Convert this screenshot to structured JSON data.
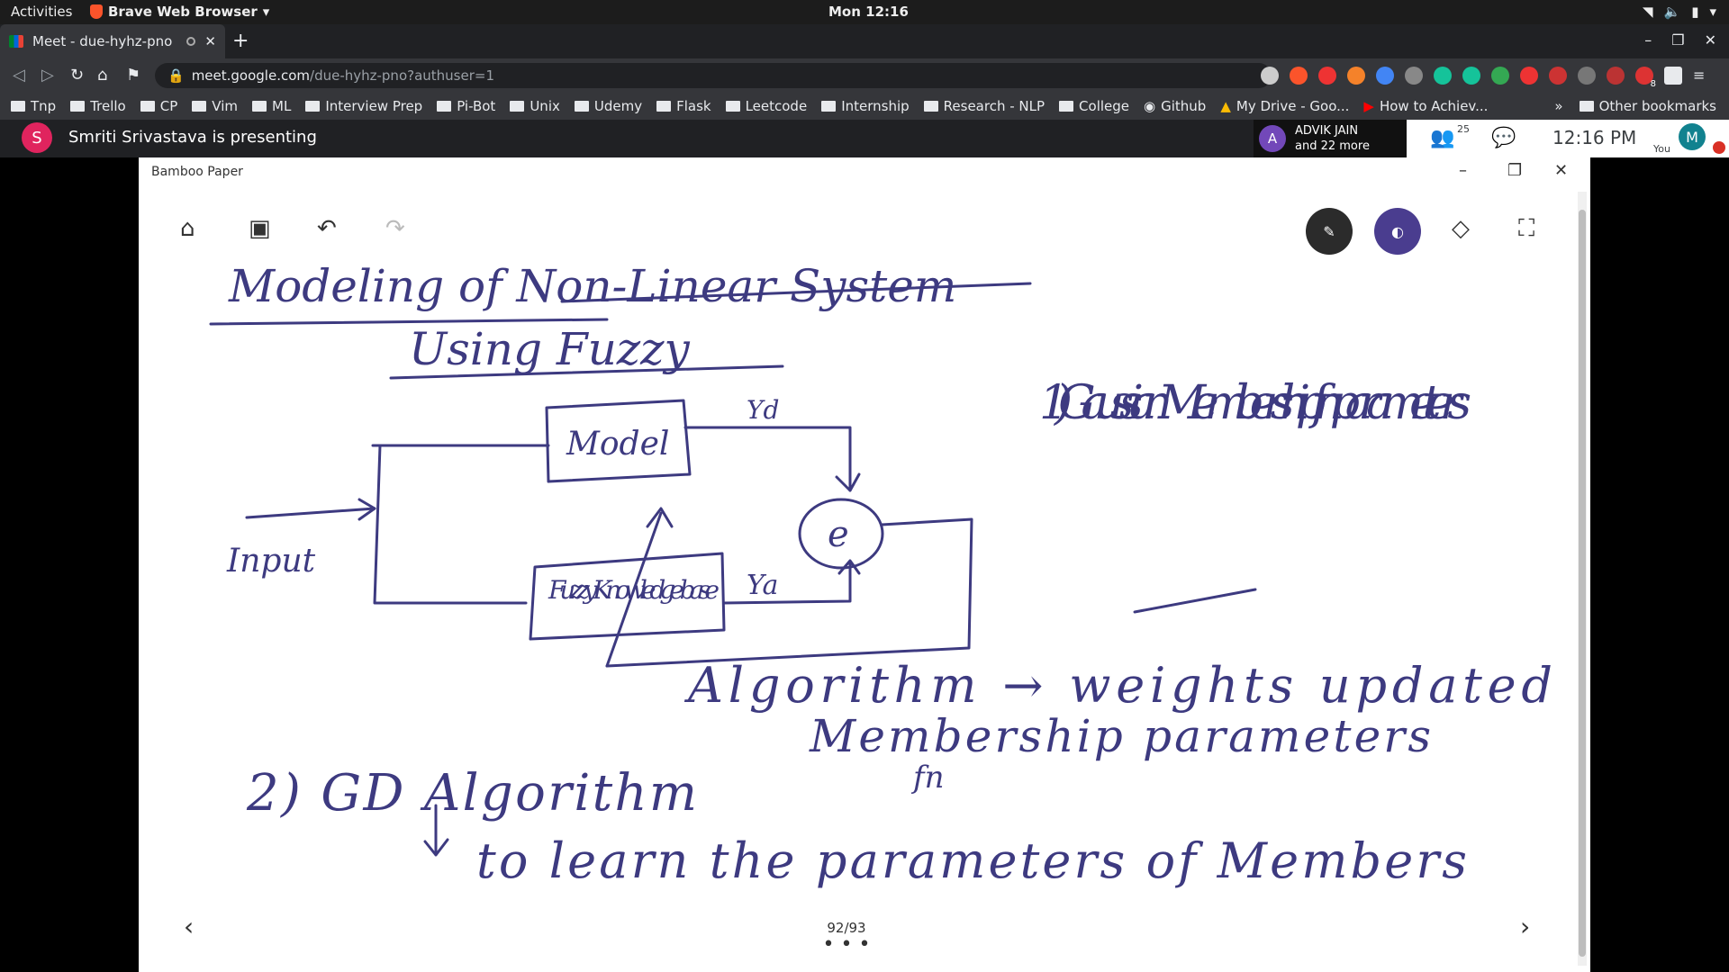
{
  "topbar": {
    "activities": "Activities",
    "app_name": "Brave Web Browser",
    "clock": "Mon 12:16"
  },
  "browser": {
    "tab_title": "Meet - due-hyhz-pno",
    "url_host": "meet.google.com",
    "url_path": "/due-hyhz-pno?authuser=1",
    "bookmarks": [
      "Tnp",
      "Trello",
      "CP",
      "Vim",
      "ML",
      "Interview Prep",
      "Pi-Bot",
      "Unix",
      "Udemy",
      "Flask",
      "Leetcode",
      "Internship",
      "Research - NLP",
      "College",
      "Github",
      "My Drive - Goo...",
      "How to Achiev..."
    ],
    "other_bookmarks": "Other bookmarks",
    "extension_badge": "8"
  },
  "meet": {
    "presenter_initial": "S",
    "presenting_text": "Smriti Srivastava is presenting",
    "participant_initial": "A",
    "participant_name": "ADVIK JAIN",
    "participant_more": "and 22 more",
    "people_count": "25",
    "time": "12:16 PM",
    "me_initial": "M",
    "me_label": "You"
  },
  "bamboo": {
    "title": "Bamboo Paper",
    "page_indicator": "92/93",
    "more": "• • •"
  },
  "notes": {
    "title_line1": "Modeling of Non-Linear System",
    "title_line2": "Using Fuzzy",
    "model_box": "Model",
    "yd": "Yd",
    "input": "Input",
    "fuzzy_box": "Fuzzy Knowledge base",
    "ya": "Ya",
    "error": "e",
    "point1": "1) Gaussian Membership fn parameters",
    "algorithm_line": "Algorithm → weights updated",
    "membership_line": "Membership parameters",
    "fn_label": "fn",
    "point2": "2) GD Algorithm",
    "learn_line": "to learn the parameters of Members"
  },
  "colors": {
    "ink": "#3d3a80",
    "pen_active": "#2b2b2b",
    "highlighter": "#4a3d8f"
  }
}
